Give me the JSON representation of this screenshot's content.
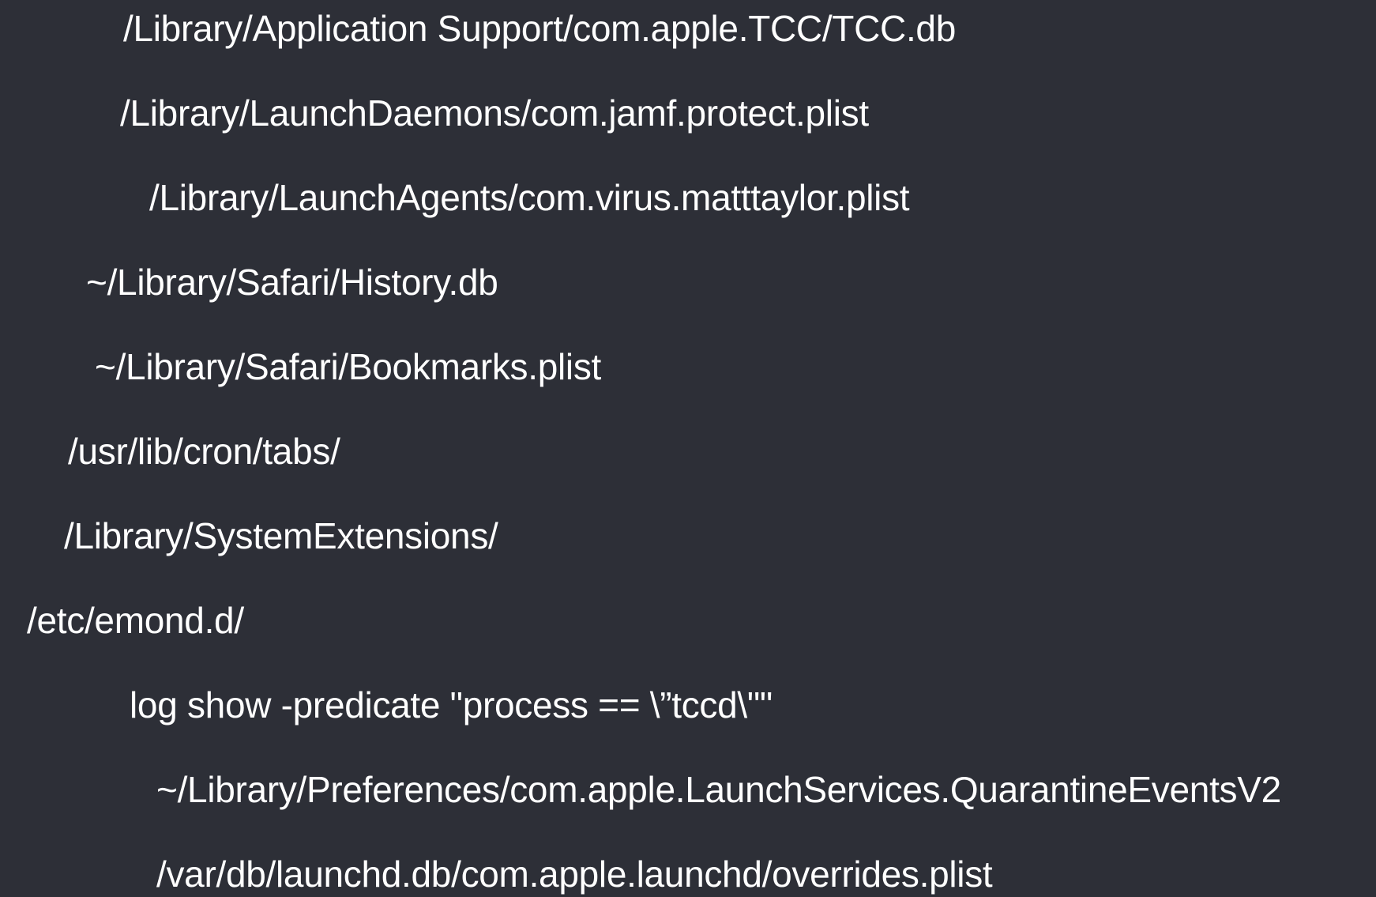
{
  "lines": [
    "/Library/Application Support/com.apple.TCC/TCC.db",
    "/Library/LaunchDaemons/com.jamf.protect.plist",
    "/Library/LaunchAgents/com.virus.matttaylor.plist",
    "~/Library/Safari/History.db",
    "~/Library/Safari/Bookmarks.plist",
    "/usr/lib/cron/tabs/",
    "/Library/SystemExtensions/",
    "/etc/emond.d/",
    "log show -predicate \"process == \\”tccd\\\"\"",
    "~/Library/Preferences/com.apple.LaunchServices.QuarantineEventsV2",
    "/var/db/launchd.db/com.apple.launchd/overrides.plist"
  ],
  "colors": {
    "background": "#2d2f37",
    "text": "#ffffff"
  }
}
